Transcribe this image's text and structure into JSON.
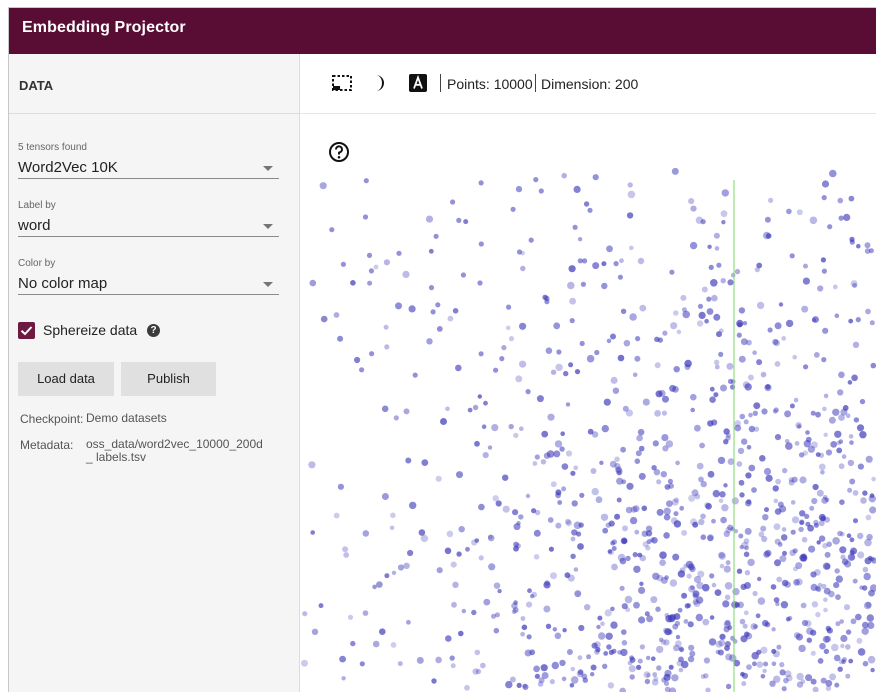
{
  "app": {
    "title": "Embedding Projector"
  },
  "sidebar": {
    "title": "DATA",
    "tensor": {
      "label": "5 tensors found",
      "value": "Word2Vec 10K"
    },
    "label_by": {
      "label": "Label by",
      "value": "word"
    },
    "color_by": {
      "label": "Color by",
      "value": "No color map"
    },
    "sphereize": {
      "label": "Sphereize data",
      "checked": true
    },
    "buttons": {
      "load": "Load data",
      "publish": "Publish"
    },
    "checkpoint": {
      "key": "Checkpoint:",
      "value": "Demo datasets"
    },
    "metadata": {
      "key": "Metadata:",
      "value": "oss_data/word2vec_10000_200d_ labels.tsv"
    }
  },
  "toolbar": {
    "icons": [
      "selection-box-icon",
      "night-mode-icon",
      "labels-icon"
    ],
    "points_label": "Points: 10000",
    "dimension_label": "Dimension: 200"
  },
  "colors": {
    "header": "#5a0d34",
    "checkbox": "#6d1a43",
    "point": "#3a36b8",
    "axis": "#7ed66a"
  }
}
